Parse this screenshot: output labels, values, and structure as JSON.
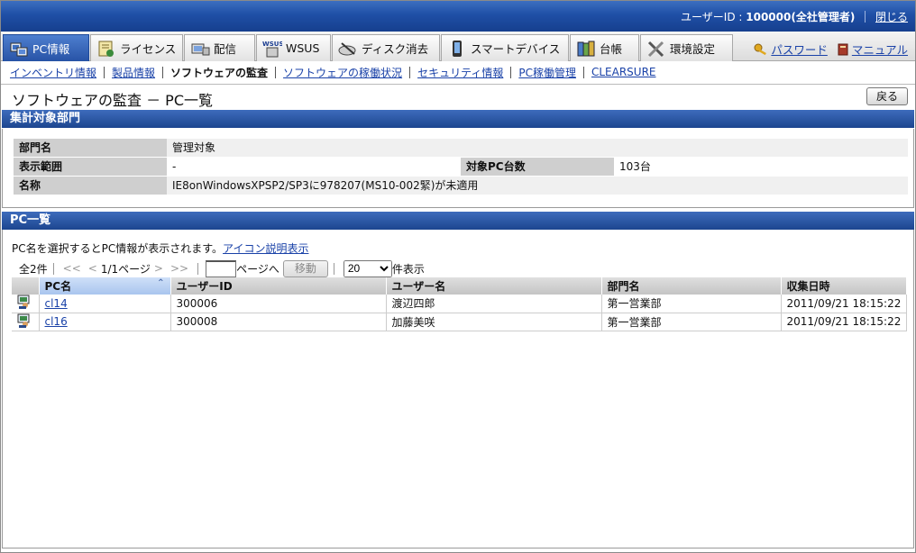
{
  "header": {
    "user_label": "ユーザーID :",
    "user_value": "100000(全社管理者)",
    "close_link": "閉じる"
  },
  "tabs": [
    {
      "label": "PC情報",
      "icon": "pc-icon",
      "active": true
    },
    {
      "label": "ライセンス",
      "icon": "license-icon",
      "active": false
    },
    {
      "label": "配信",
      "icon": "distribution-icon",
      "active": false
    },
    {
      "label": "WSUS",
      "icon": "wsus-icon",
      "active": false
    },
    {
      "label": "ディスク消去",
      "icon": "disk-erase-icon",
      "active": false
    },
    {
      "label": "スマートデバイス",
      "icon": "smart-device-icon",
      "active": false
    },
    {
      "label": "台帳",
      "icon": "ledger-icon",
      "active": false
    },
    {
      "label": "環境設定",
      "icon": "settings-icon",
      "active": false
    }
  ],
  "toplinks": {
    "password": "パスワード",
    "manual": "マニュアル"
  },
  "subnav": [
    {
      "label": "インベントリ情報",
      "current": false
    },
    {
      "label": "製品情報",
      "current": false
    },
    {
      "label": "ソフトウェアの監査",
      "current": true
    },
    {
      "label": "ソフトウェアの稼働状況",
      "current": false
    },
    {
      "label": "セキュリティ情報",
      "current": false
    },
    {
      "label": "PC稼働管理",
      "current": false
    },
    {
      "label": "CLEARSURE",
      "current": false
    }
  ],
  "page": {
    "title": "ソフトウェアの監査 － PC一覧",
    "back_button": "戻る"
  },
  "dept_section": {
    "heading": "集計対象部門",
    "rows": {
      "dept_label": "部門名",
      "dept_value": "管理対象",
      "range_label": "表示範囲",
      "range_value": "-",
      "target_label": "対象PC台数",
      "target_value": "103台",
      "name_label": "名称",
      "name_value": "IE8onWindowsXPSP2/SP3に978207(MS10-002緊)が未適用"
    }
  },
  "pc_section": {
    "heading": "PC一覧",
    "note_text": "PC名を選択するとPC情報が表示されます。",
    "note_link": "アイコン説明表示",
    "pager": {
      "total": "全2件",
      "first": "<<",
      "prev": "<",
      "page_info": "1/1ページ",
      "next": ">",
      "last": ">>",
      "goto_label": "ページへ",
      "move_button": "移動",
      "per_page": "20",
      "per_page_suffix": "件表示"
    },
    "columns": [
      "PC名",
      "ユーザーID",
      "ユーザー名",
      "部門名",
      "収集日時"
    ],
    "rows": [
      {
        "pc": "cl14",
        "user_id": "300006",
        "user_name": "渡辺四郎",
        "dept": "第一営業部",
        "date": "2011/09/21 18:15:22"
      },
      {
        "pc": "cl16",
        "user_id": "300008",
        "user_name": "加藤美咲",
        "dept": "第一営業部",
        "date": "2011/09/21 18:15:22"
      }
    ]
  },
  "colors": {
    "header_blue": "#1f4fa6",
    "link_blue": "#1a42a8",
    "section_blue": "#2a55a0"
  }
}
